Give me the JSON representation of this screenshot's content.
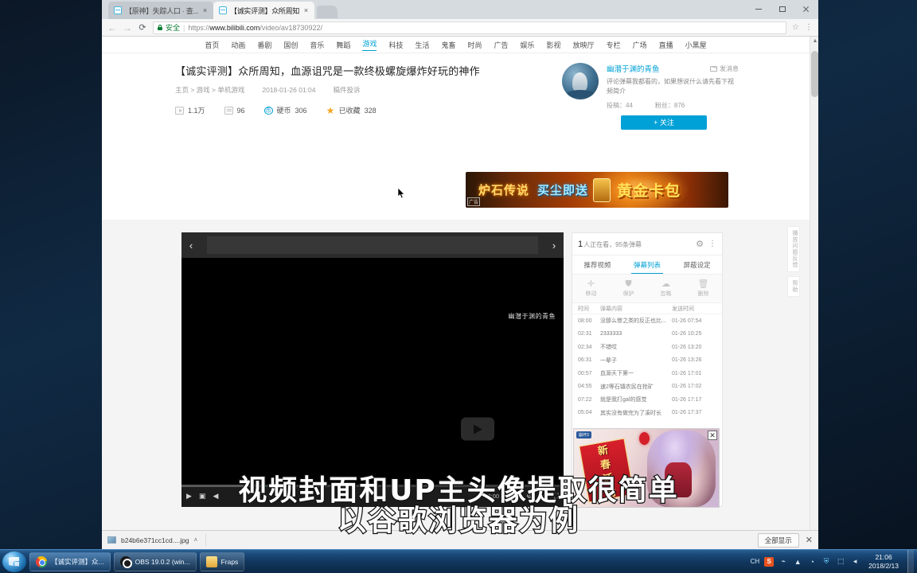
{
  "browser": {
    "tabs": [
      {
        "title": "【原神】失踪人口 · 查...",
        "active": false,
        "close": "×"
      },
      {
        "title": "【诚实评测】众所周知",
        "active": true,
        "close": "×"
      }
    ],
    "address": {
      "secure_label": "安全",
      "protocol": "https://",
      "host": "www.bilibili.com",
      "path": "/video/av18730922/",
      "full_url": "https://www.bilibili.com/video/av18730922/"
    },
    "back_icon": "←",
    "forward_icon": "→",
    "reload_icon": "⟳",
    "star_icon": "☆",
    "menu_icon": "⋮",
    "window_controls": {
      "minimize": "—",
      "maximize": "□",
      "close": "✕"
    }
  },
  "site_nav": [
    {
      "label": "首页",
      "active": false
    },
    {
      "label": "动画",
      "active": false
    },
    {
      "label": "番剧",
      "active": false
    },
    {
      "label": "国创",
      "active": false
    },
    {
      "label": "音乐",
      "active": false
    },
    {
      "label": "舞蹈",
      "active": false
    },
    {
      "label": "游戏",
      "active": true
    },
    {
      "label": "科技",
      "active": false
    },
    {
      "label": "生活",
      "active": false
    },
    {
      "label": "鬼畜",
      "active": false
    },
    {
      "label": "时尚",
      "active": false
    },
    {
      "label": "广告",
      "active": false
    },
    {
      "label": "娱乐",
      "active": false
    },
    {
      "label": "影视",
      "active": false
    },
    {
      "label": "放映厅",
      "active": false
    },
    {
      "label": "专栏",
      "active": false
    },
    {
      "label": "广场",
      "active": false
    },
    {
      "label": "直播",
      "active": false
    },
    {
      "label": "小黑屋",
      "active": false
    }
  ],
  "video": {
    "title": "【诚实评测】众所周知，血源诅咒是一款终极螺旋爆炸好玩的神作",
    "breadcrumb": "主页 > 游戏 > 单机游戏",
    "publish_time": "2018-01-26 01:04",
    "report_link": "稿件投诉",
    "stats": {
      "views_label": "1.1万",
      "danmaku_label": "96",
      "coin_name": "硬币",
      "coin_count": "306",
      "fav_name": "已收藏",
      "fav_count": "328",
      "coin_icon_text": "币"
    }
  },
  "uploader": {
    "name": "幽潜于渊的青鱼",
    "message_label": "发消息",
    "signature": "评论弹幕我都看的，如果想说什么请先看下视频简介",
    "uploads_label": "投稿：44",
    "fans_label": "粉丝：876",
    "follow_label": "+ 关注"
  },
  "ad_banner": {
    "game": "炉石传说",
    "middle": "买尘即送",
    "highlight": "黄金卡包",
    "tag": "广告"
  },
  "player": {
    "prev_icon": "‹",
    "next_icon": "›",
    "watermark": "幽潜于渊的青鱼",
    "time": "00:00 / 15:02",
    "controls": [
      "play",
      "danmaku-toggle",
      "volume",
      "settings",
      "wide-screen",
      "fullscreen"
    ],
    "play_icon": "▶",
    "danmaku_icon": "▣",
    "volume_icon": "◀",
    "settings_icon": "⚙",
    "widescreen_icon": "▭",
    "fullscreen_icon": "⛶"
  },
  "side_panel": {
    "viewers_count": "1",
    "viewers_suffix": "人正在看，95条弹幕",
    "gear_icon": "⚙",
    "kebab_icon": "⋮",
    "tabs": [
      {
        "label": "推荐视频",
        "active": false
      },
      {
        "label": "弹幕列表",
        "active": true
      },
      {
        "label": "屏蔽设定",
        "active": false
      }
    ],
    "actions": [
      {
        "label": "移动",
        "icon": "✛"
      },
      {
        "label": "保护",
        "icon": "⛊"
      },
      {
        "label": "忽略",
        "icon": "☁"
      },
      {
        "label": "删除",
        "icon": "Ὕ1"
      }
    ],
    "columns": {
      "time": "时间",
      "content": "弹幕内容",
      "sent": "发送时间"
    },
    "rows": [
      {
        "time": "08:00",
        "content": "没那么惨之类的反正也比...",
        "sent": "01-26 07:54"
      },
      {
        "time": "02:31",
        "content": "2333333",
        "sent": "01-26 10:25"
      },
      {
        "time": "02:34",
        "content": "不错哎",
        "sent": "01-26 13:20"
      },
      {
        "time": "06:31",
        "content": "一辈子",
        "sent": "01-26 13:26"
      },
      {
        "time": "00:57",
        "content": "血源天下第一",
        "sent": "01-26 17:01"
      },
      {
        "time": "04:55",
        "content": "速2等石镇农民在抢矿",
        "sent": "01-26 17:02"
      },
      {
        "time": "07:22",
        "content": "就是我打gal的感觉",
        "sent": "01-26 17:17"
      },
      {
        "time": "05:04",
        "content": "其实没有做完为了凑时长",
        "sent": "01-26 17:37"
      }
    ]
  },
  "popup_ad": {
    "brand": "崩坏3",
    "line1": "新",
    "line2": "春",
    "line3": "活",
    "line4": "动",
    "close_icon": "✕"
  },
  "side_vertical_tabs": [
    {
      "label": "播放问题反馈"
    },
    {
      "label": "帮助"
    }
  ],
  "download_shelf": {
    "file_name": "b24b6e371cc1cd....jpg",
    "caret_icon": "˄",
    "show_all_label": "全部显示",
    "close_icon": "✕"
  },
  "subtitles": {
    "line1": "视频封面和UP主头像提取很简单",
    "line2": "以谷歌浏览器为例"
  },
  "taskbar": {
    "start_label": "start",
    "items": [
      {
        "label": "【诚实评测】众...",
        "icon": "chrome",
        "active": true
      },
      {
        "label": "OBS 19.0.2 (win...",
        "icon": "obs",
        "active": false
      },
      {
        "label": "Fraps",
        "icon": "fraps",
        "active": false
      }
    ],
    "tray": {
      "ime": "CH",
      "sogou": "S",
      "expand_icon": "▲",
      "network_icon": "◔",
      "shield_icon": "⛨",
      "monitor_icon": "⬚",
      "volume_icon": "◂"
    },
    "clock_time": "21:06",
    "clock_date": "2018/2/13"
  },
  "colors": {
    "accent": "#00a1d6",
    "secure_green": "#0a7b34",
    "taskbar_blue": "#1b4a7a",
    "coin_orange": "#f5a623"
  }
}
